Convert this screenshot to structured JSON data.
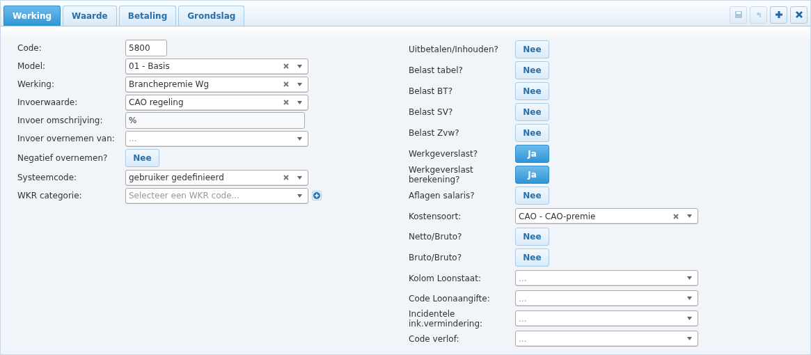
{
  "tabs": [
    {
      "label": "Werking",
      "selected": true
    },
    {
      "label": "Waarde",
      "selected": false
    },
    {
      "label": "Betaling",
      "selected": false
    },
    {
      "label": "Grondslag",
      "selected": false
    }
  ],
  "toolbar": [
    {
      "kind": "save",
      "disabled": true
    },
    {
      "kind": "undo",
      "disabled": true
    },
    {
      "kind": "add",
      "disabled": false
    },
    {
      "kind": "close",
      "disabled": false
    }
  ],
  "left_fields": [
    {
      "kind": "text",
      "label": "Code:",
      "value": "5800",
      "short": true
    },
    {
      "kind": "select",
      "label": "Model:",
      "value": "01 - Basis"
    },
    {
      "kind": "select",
      "label": "Werking:",
      "value": "Branchepremie Wg"
    },
    {
      "kind": "select",
      "label": "Invoerwaarde:",
      "value": "CAO regeling"
    },
    {
      "kind": "text",
      "label": "Invoer omschrijving:",
      "value": "%",
      "short": false
    },
    {
      "kind": "select",
      "label": "Invoer overnemen van:",
      "placeholder": "..."
    },
    {
      "kind": "toggle",
      "label": "Negatief overnemen?",
      "value": "Nee",
      "on": false
    },
    {
      "kind": "select",
      "label": "Systeemcode:",
      "value": "gebruiker gedefinieerd"
    },
    {
      "kind": "select_add",
      "label": "WKR categorie:",
      "placeholder": "Selecteer een WKR code..."
    }
  ],
  "right_fields": [
    {
      "kind": "toggle",
      "label": "Uitbetalen/Inhouden?",
      "value": "Nee",
      "on": false
    },
    {
      "kind": "toggle",
      "label": "Belast tabel?",
      "value": "Nee",
      "on": false
    },
    {
      "kind": "toggle",
      "label": "Belast BT?",
      "value": "Nee",
      "on": false
    },
    {
      "kind": "toggle",
      "label": "Belast SV?",
      "value": "Nee",
      "on": false
    },
    {
      "kind": "toggle",
      "label": "Belast Zvw?",
      "value": "Nee",
      "on": false
    },
    {
      "kind": "toggle",
      "label": "Werkgeverslast?",
      "value": "Ja",
      "on": true
    },
    {
      "kind": "toggle",
      "label": "Werkgeverslast berekening?",
      "value": "Ja",
      "on": true
    },
    {
      "kind": "toggle",
      "label": "Aflagen salaris?",
      "value": "Nee",
      "on": false
    },
    {
      "kind": "select",
      "label": "Kostensoort:",
      "value": "CAO - CAO-premie"
    },
    {
      "kind": "toggle",
      "label": "Netto/Bruto?",
      "value": "Nee",
      "on": false
    },
    {
      "kind": "toggle",
      "label": "Bruto/Bruto?",
      "value": "Nee",
      "on": false
    },
    {
      "kind": "select",
      "label": "Kolom Loonstaat:",
      "placeholder": "..."
    },
    {
      "kind": "select",
      "label": "Code Loonaangifte:",
      "placeholder": "..."
    },
    {
      "kind": "select",
      "label": "Incidentele ink.vermindering:",
      "placeholder": "..."
    },
    {
      "kind": "select",
      "label": "Code verlof:",
      "placeholder": "..."
    }
  ]
}
